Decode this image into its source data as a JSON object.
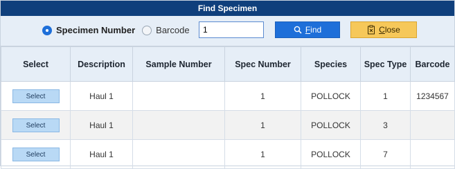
{
  "window": {
    "title": "Find Specimen"
  },
  "search": {
    "mode_options": [
      {
        "label": "Specimen Number",
        "checked": true
      },
      {
        "label": "Barcode",
        "checked": false
      }
    ],
    "input_value": "1",
    "find_icon": "search-icon",
    "find_label_first": "F",
    "find_label_rest": "ind",
    "close_icon": "clipboard-close-icon",
    "close_label_first": "C",
    "close_label_rest": "lose"
  },
  "colors": {
    "title_bar": "#0f3f7c",
    "find_button": "#1e6fd9",
    "close_button": "#f6c85a",
    "select_button": "#b9d9f5"
  },
  "table": {
    "columns": [
      "Select",
      "Description",
      "Sample Number",
      "Spec Number",
      "Species",
      "Spec Type",
      "Barcode"
    ],
    "rows": [
      {
        "select_label": "Select",
        "description": "Haul 1",
        "sample_number": "",
        "spec_number": "1",
        "species": "POLLOCK",
        "spec_type": "1",
        "barcode": "1234567"
      },
      {
        "select_label": "Select",
        "description": "Haul 1",
        "sample_number": "",
        "spec_number": "1",
        "species": "POLLOCK",
        "spec_type": "3",
        "barcode": ""
      },
      {
        "select_label": "Select",
        "description": "Haul 1",
        "sample_number": "",
        "spec_number": "1",
        "species": "POLLOCK",
        "spec_type": "7",
        "barcode": ""
      }
    ]
  }
}
